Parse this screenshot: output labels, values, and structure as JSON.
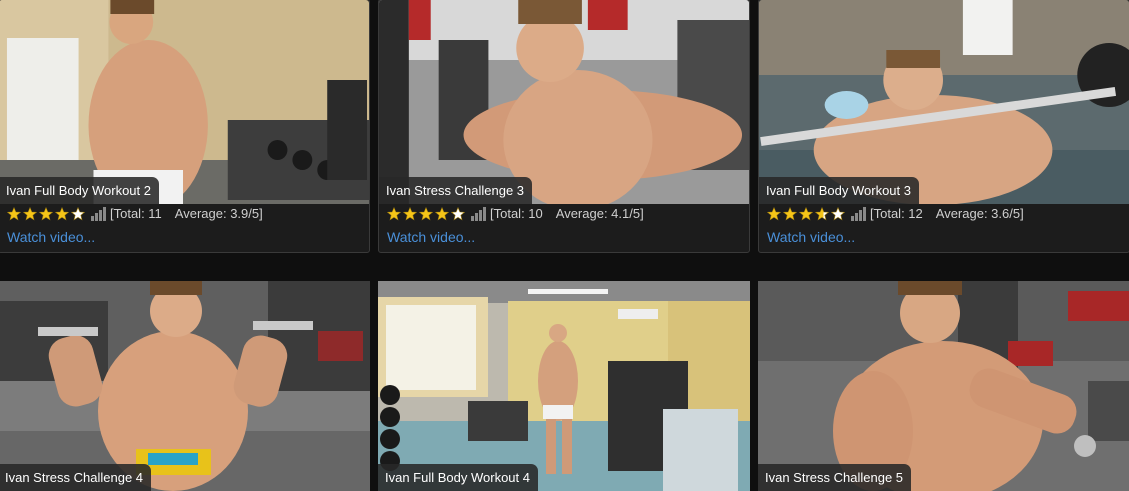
{
  "accent_color": "#4a90d9",
  "star_color": "#f5c518",
  "videos": [
    {
      "title": "Ivan Full Body Workout 2",
      "rating": 3.9,
      "total_label": "[Total: 11",
      "average_label": "Average: 3.9/5]",
      "link_label": "Watch video...",
      "thumb_icon": "video-thumbnail"
    },
    {
      "title": "Ivan Stress Challenge 3",
      "rating": 4.1,
      "total_label": "[Total: 10",
      "average_label": "Average: 4.1/5]",
      "link_label": "Watch video...",
      "thumb_icon": "video-thumbnail"
    },
    {
      "title": "Ivan Full Body Workout 3",
      "rating": 3.6,
      "total_label": "[Total: 12",
      "average_label": "Average: 3.6/5]",
      "link_label": "Watch video...",
      "thumb_icon": "video-thumbnail"
    },
    {
      "title": "Ivan Stress Challenge 4",
      "link_label": "",
      "thumb_icon": "video-thumbnail"
    },
    {
      "title": "Ivan Full Body Workout 4",
      "link_label": "",
      "thumb_icon": "video-thumbnail"
    },
    {
      "title": "Ivan Stress Challenge 5",
      "link_label": "",
      "thumb_icon": "video-thumbnail"
    }
  ]
}
